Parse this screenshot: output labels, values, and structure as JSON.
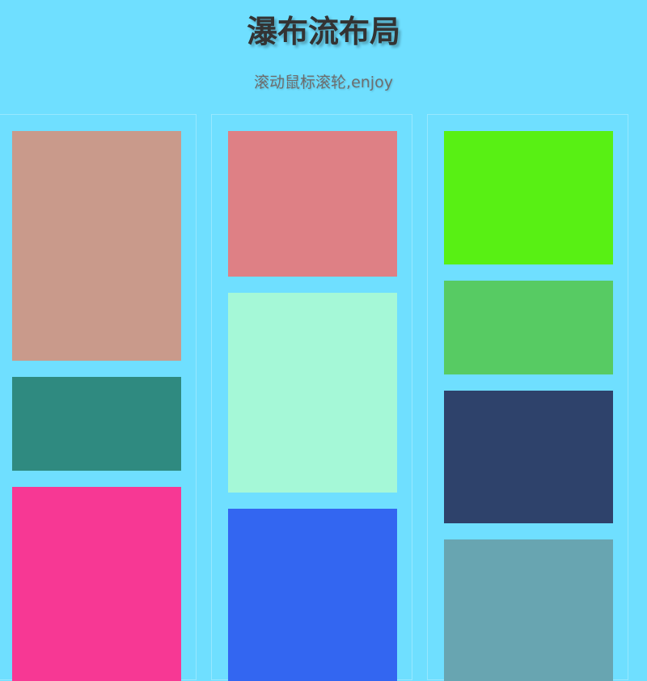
{
  "colors": {
    "background": "#6fdfff"
  },
  "header": {
    "title": "瀑布流布局",
    "subtitle": "滚动鼠标滚轮,enjoy"
  },
  "columns": [
    {
      "tiles": [
        {
          "color": "#c99a8b"
        },
        {
          "color": "#2f8a80"
        },
        {
          "color": "#f73894"
        }
      ]
    },
    {
      "tiles": [
        {
          "color": "#de8085"
        },
        {
          "color": "#a5f8d7"
        },
        {
          "color": "#3366f1"
        }
      ]
    },
    {
      "tiles": [
        {
          "color": "#58f014"
        },
        {
          "color": "#57cb63"
        },
        {
          "color": "#2e426b"
        },
        {
          "color": "#68a5b1"
        }
      ]
    }
  ]
}
